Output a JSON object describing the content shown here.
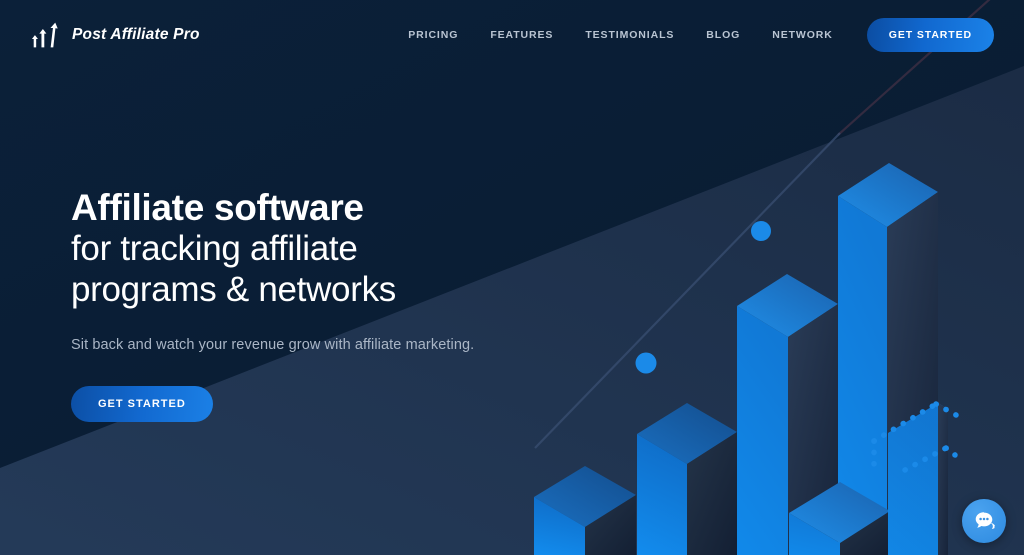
{
  "page": {
    "title": "Post Affiliate Pro — Affiliate software hero",
    "background_dark": "#0a1d33",
    "background_light": "#223551",
    "accent": "#1b80e6"
  },
  "header": {
    "logo": {
      "icon": "bar-arrows-icon",
      "name": "Post Affiliate Pro"
    },
    "nav_items": [
      {
        "label": "PRICING",
        "name": "nav-link-pricing"
      },
      {
        "label": "FEATURES",
        "name": "nav-link-features"
      },
      {
        "label": "TESTIMONIALS",
        "name": "nav-link-testimonials"
      },
      {
        "label": "BLOG",
        "name": "nav-link-blog"
      },
      {
        "label": "NETWORK",
        "name": "nav-link-network"
      }
    ],
    "cta_label": "GET STARTED"
  },
  "hero": {
    "headline_line1": "Affiliate software",
    "headline_line2": "for tracking affiliate",
    "headline_line3": "programs & networks",
    "subtitle": "Sit back and watch your revenue grow with affiliate marketing.",
    "cta_label": "GET STARTED"
  },
  "illustration": {
    "description": "Isometric 3D blue bar chart with rising trend line and dotted outline",
    "bar_colors": {
      "left_face_bright": "#1186e8",
      "left_face_deep": "#0d63c4",
      "top_face": "#1f6fc4",
      "top_face_deep": "#14508f",
      "right_face": "#25344c"
    },
    "trend_line_color": "#31476a",
    "dot_color": "#1b8ae8"
  },
  "chat_widget": {
    "icon": "chat-bubble-dots-icon",
    "label": "Open live chat"
  }
}
